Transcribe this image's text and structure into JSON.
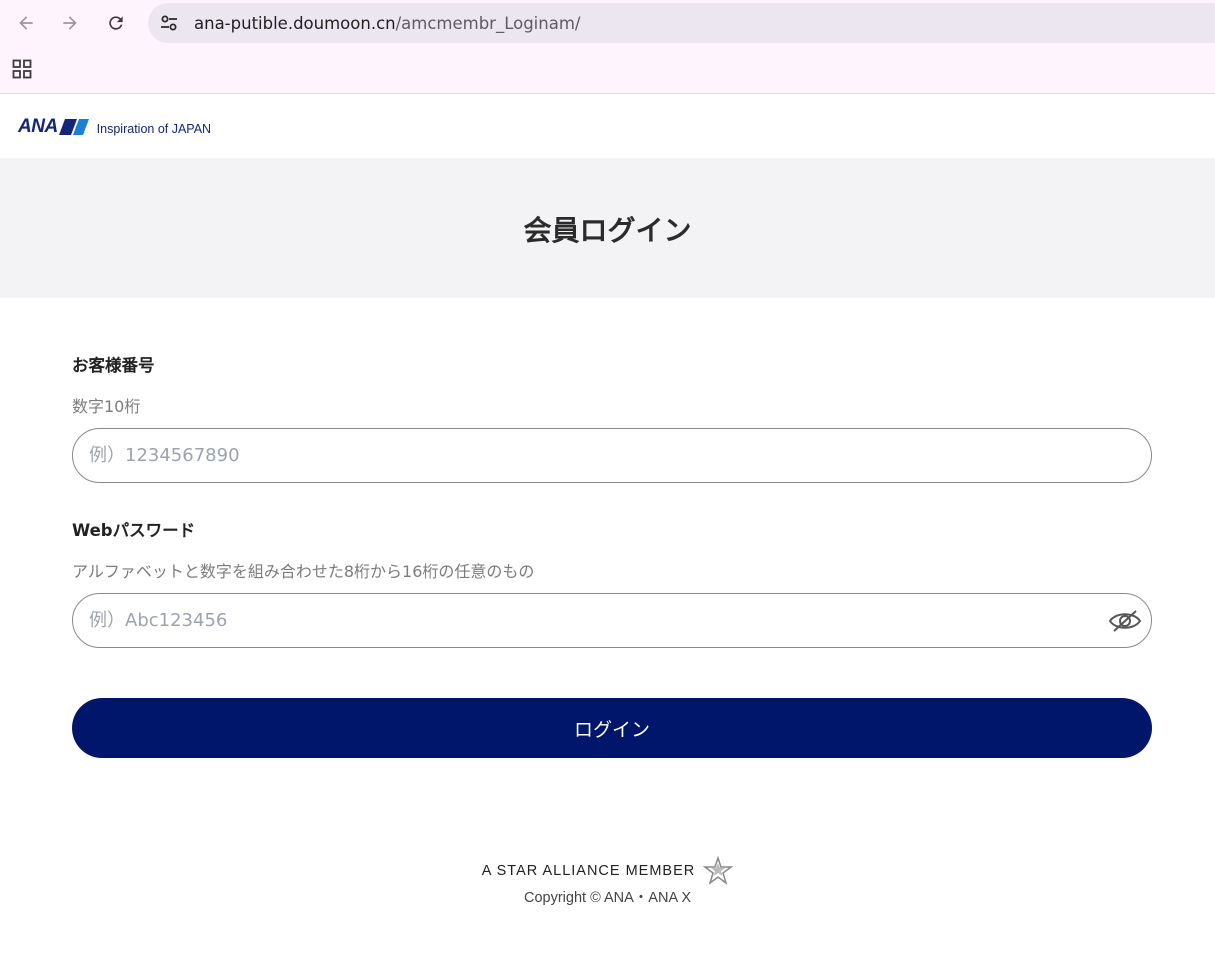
{
  "browser": {
    "url_host": "ana-putible.doumoon.cn",
    "url_path": "/amcmembr_Loginam/",
    "icons": {
      "back": "arrow-left-icon",
      "forward": "arrow-right-icon",
      "reload": "reload-icon",
      "site_info": "tune-icon",
      "apps": "apps-grid-icon"
    }
  },
  "header": {
    "logo_word": "ANA",
    "logo_tagline": "Inspiration of JAPAN",
    "brand_color": "#13267a"
  },
  "page": {
    "title": "会員ログイン"
  },
  "form": {
    "customer_number": {
      "label": "お客様番号",
      "hint": "数字10桁",
      "placeholder": "例）1234567890",
      "value": ""
    },
    "password": {
      "label": "Webパスワード",
      "hint": "アルファベットと数字を組み合わせた8桁から16桁の任意のもの",
      "placeholder": "例）Abc123456",
      "value": "",
      "toggle_icon": "eye-off-icon"
    },
    "login_button": {
      "label": "ログイン",
      "color": "#00166b"
    }
  },
  "footer": {
    "alliance": "A STAR ALLIANCE MEMBER",
    "copyright": "Copyright © ANA・ANA X"
  }
}
